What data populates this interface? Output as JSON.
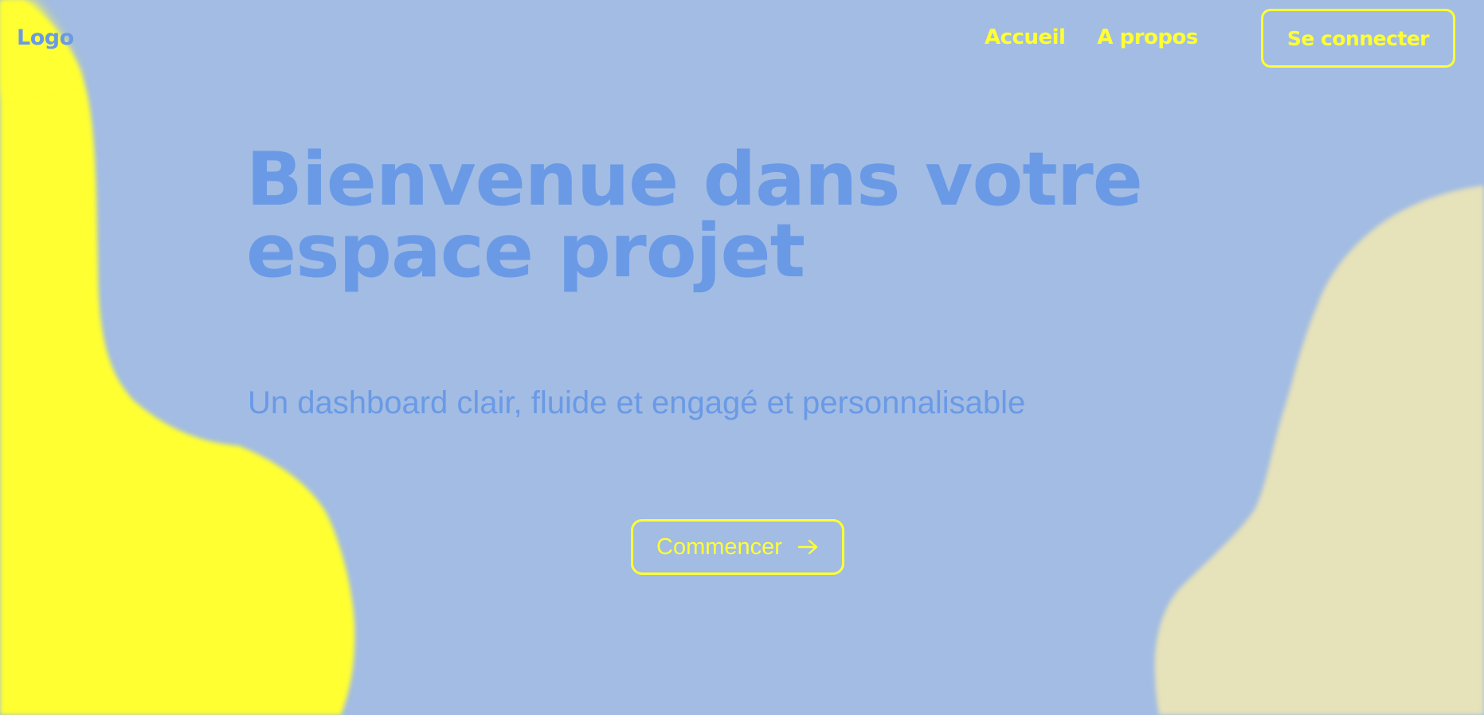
{
  "header": {
    "logo": "Logo",
    "nav": [
      {
        "label": "Accueil"
      },
      {
        "label": "A propos"
      }
    ],
    "login_label": "Se connecter"
  },
  "hero": {
    "title_line1": "Bienvenue dans votre",
    "title_line2": "espace projet",
    "subtitle": "Un dashboard clair, fluide et engagé et personnalisable",
    "cta_label": "Commencer",
    "cta_icon": "arrow-right-icon"
  },
  "colors": {
    "background": "#a2bce3",
    "accent_yellow": "#ffff33",
    "text_blue": "#6a9ae6",
    "blob_cream": "#e6e2b9"
  }
}
